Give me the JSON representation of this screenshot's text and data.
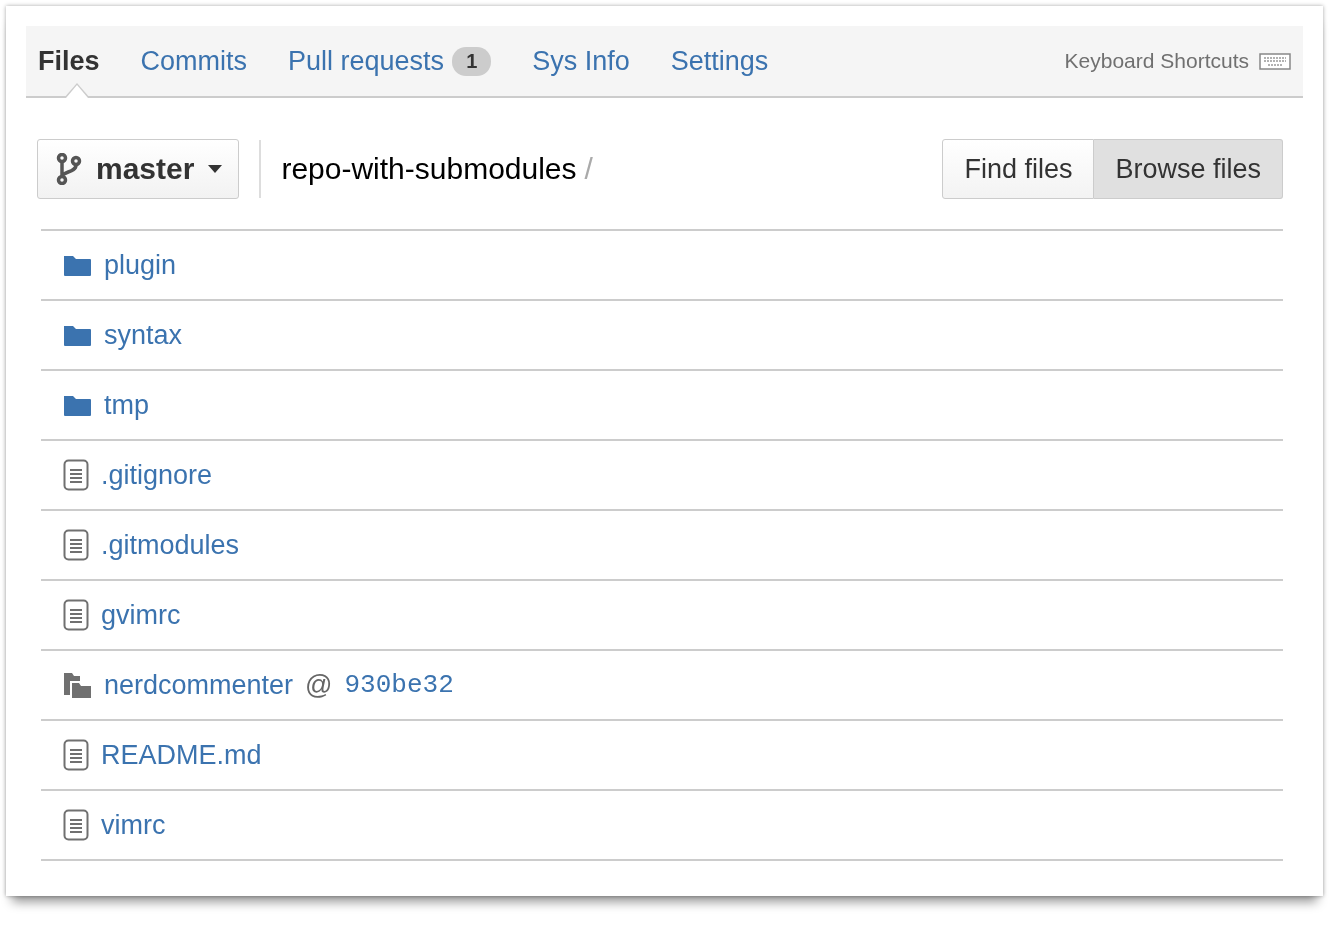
{
  "tabs": [
    {
      "label": "Files",
      "selected": true
    },
    {
      "label": "Commits",
      "selected": false
    },
    {
      "label": "Pull requests",
      "selected": false,
      "badge": "1"
    },
    {
      "label": "Sys Info",
      "selected": false
    },
    {
      "label": "Settings",
      "selected": false
    }
  ],
  "keyboard_shortcuts": "Keyboard Shortcuts",
  "branch": "master",
  "breadcrumb": {
    "repo": "repo-with-submodules",
    "separator": "/"
  },
  "view_buttons": [
    {
      "label": "Find files",
      "selected": false
    },
    {
      "label": "Browse files",
      "selected": true
    }
  ],
  "files": [
    {
      "kind": "folder",
      "name": "plugin"
    },
    {
      "kind": "folder",
      "name": "syntax"
    },
    {
      "kind": "folder",
      "name": "tmp"
    },
    {
      "kind": "file",
      "name": ".gitignore"
    },
    {
      "kind": "file",
      "name": ".gitmodules"
    },
    {
      "kind": "file",
      "name": "gvimrc"
    },
    {
      "kind": "submodule",
      "name": "nerdcommenter",
      "at": "@",
      "commit": "930be32"
    },
    {
      "kind": "file",
      "name": "README.md"
    },
    {
      "kind": "file",
      "name": "vimrc"
    }
  ]
}
